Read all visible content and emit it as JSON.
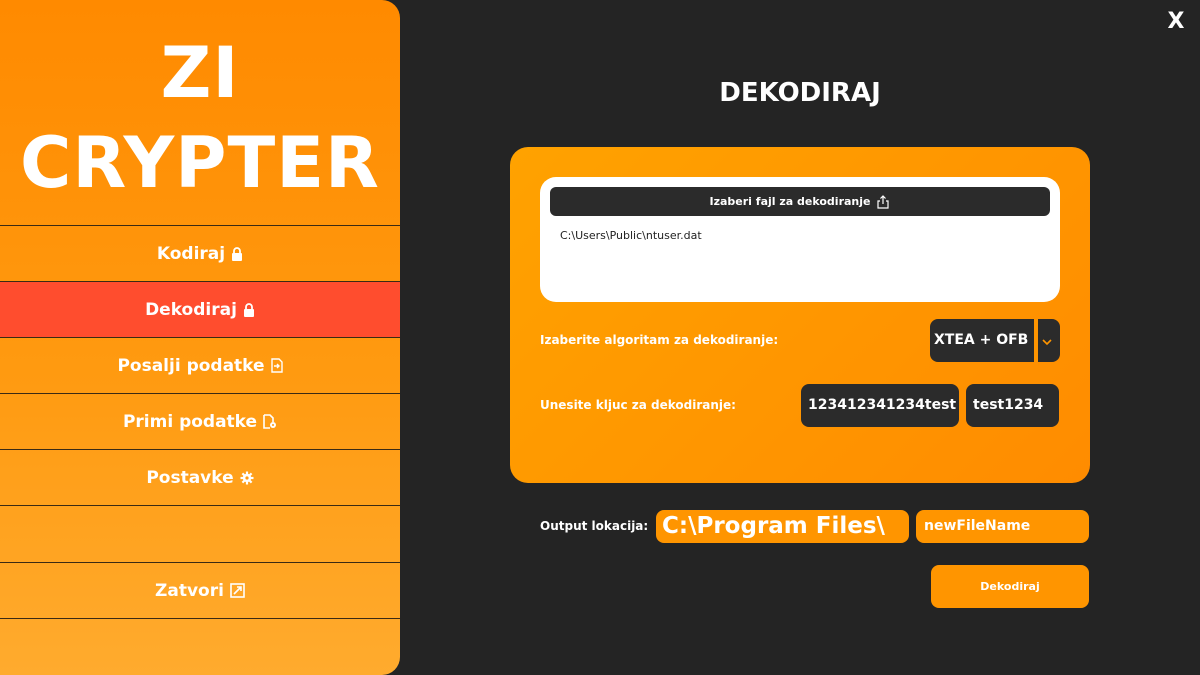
{
  "app": {
    "logo_line1": "ZI",
    "logo_line2": "CRYPTER",
    "close_label": "X"
  },
  "sidebar": {
    "items": [
      {
        "label": "Kodiraj",
        "icon": "lock-icon"
      },
      {
        "label": "Dekodiraj",
        "icon": "lock-icon",
        "active": true
      },
      {
        "label": "Posalji podatke",
        "icon": "file-export-icon"
      },
      {
        "label": "Primi podatke",
        "icon": "file-settings-icon"
      },
      {
        "label": "Postavke",
        "icon": "gear-icon"
      },
      {
        "label": "Zatvori",
        "icon": "exit-icon"
      }
    ]
  },
  "main": {
    "title": "DEKODIRAJ",
    "file_button_label": "Izaberi fajl za dekodiranje",
    "file_button_icon": "share-upload-icon",
    "file_path": "C:\\Users\\Public\\ntuser.dat",
    "algorithm_label": "Izaberite algoritam za dekodiranje:",
    "algorithm_value": "XTEA + OFB",
    "key_label": "Unesite kljuc za dekodiranje:",
    "key_value_1": "123412341234test",
    "key_value_2": "test1234",
    "output_label": "Output lokacija:",
    "output_path": "C:\\Program Files\\",
    "output_filename": "newFileName",
    "decode_button_label": "Dekodiraj"
  },
  "colors": {
    "accent": "#ff9500",
    "active_nav": "#ff4d2e",
    "background": "#242424",
    "dark_control": "#2b2b2b"
  }
}
